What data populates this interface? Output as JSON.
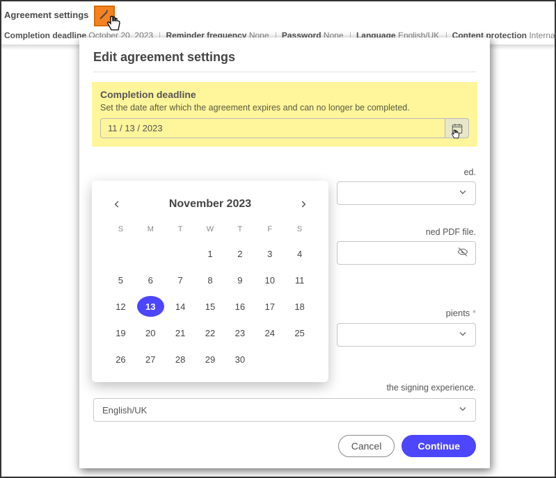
{
  "header": {
    "title": "Agreement settings",
    "summary": [
      {
        "label": "Completion deadline",
        "value": "October 20, 2023"
      },
      {
        "label": "Reminder frequency",
        "value": "None"
      },
      {
        "label": "Password",
        "value": "None"
      },
      {
        "label": "Language",
        "value": "English/UK"
      },
      {
        "label": "Content protection",
        "value": "Internal disabled & External enabled"
      }
    ]
  },
  "modal": {
    "title": "Edit agreement settings",
    "deadline": {
      "title": "Completion deadline",
      "desc": "Set the date after which the agreement expires and can no longer be completed.",
      "value": "11 /  13 /  2023"
    },
    "reminder": {
      "peek_desc_tail": "ed."
    },
    "password": {
      "peek_desc_tail": "ned PDF file."
    },
    "content_protection": {
      "peek_label_tail": "pients",
      "star": "*"
    },
    "language_desc_tail": "the signing experience.",
    "language_value": "English/UK",
    "buttons": {
      "cancel": "Cancel",
      "continue": "Continue"
    }
  },
  "calendar": {
    "month_label": "November 2023",
    "dow": [
      "S",
      "M",
      "T",
      "W",
      "T",
      "F",
      "S"
    ],
    "lead_empty": 3,
    "days": 30,
    "selected": 13
  },
  "icons": {
    "edit": "pencil-icon",
    "calendar": "calendar-icon"
  },
  "colors": {
    "accent": "#4d46ff",
    "highlight": "#fff59b",
    "edit_box": "#f58220"
  }
}
